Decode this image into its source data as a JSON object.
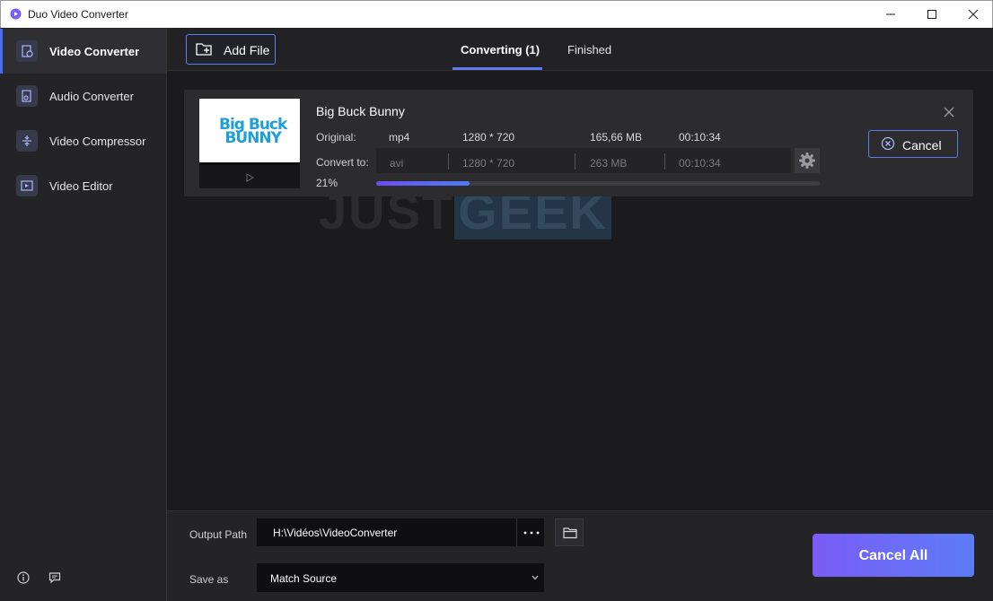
{
  "window": {
    "title": "Duo Video Converter",
    "icons": {
      "logo": "app-logo-icon",
      "minimize": "minimize-icon",
      "maximize": "maximize-icon",
      "close": "close-icon"
    }
  },
  "sidebar": {
    "items": [
      {
        "label": "Video Converter",
        "icon": "video-converter-icon",
        "active": true
      },
      {
        "label": "Audio Converter",
        "icon": "audio-converter-icon",
        "active": false
      },
      {
        "label": "Video Compressor",
        "icon": "video-compressor-icon",
        "active": false
      },
      {
        "label": "Video Editor",
        "icon": "video-editor-icon",
        "active": false
      }
    ],
    "footer_icons": [
      "info-icon",
      "feedback-icon"
    ]
  },
  "toolbar": {
    "add_file_label": "Add File",
    "add_file_icon": "add-file-icon",
    "tabs": [
      {
        "label": "Converting (1)",
        "active": true
      },
      {
        "label": "Finished",
        "active": false
      }
    ]
  },
  "watermark": {
    "part1": "JUST",
    "part2": "GEEK"
  },
  "task": {
    "thumbnail_text_line1": "Big Buck",
    "thumbnail_text_line2": "BUNNY",
    "title": "Big Buck Bunny",
    "original_label": "Original:",
    "original": {
      "format": "mp4",
      "resolution": "1280 * 720",
      "size": "165,66 MB",
      "duration": "00:10:34"
    },
    "convert_label": "Convert to:",
    "convert": {
      "format": "avi",
      "resolution": "1280 * 720",
      "size": "263 MB",
      "duration": "00:10:34"
    },
    "progress_text": "21%",
    "progress_fraction": 0.21,
    "cancel_label": "Cancel"
  },
  "bottom": {
    "output_path_label": "Output Path",
    "output_path": "H:\\Vidéos\\VideoConverter",
    "save_as_label": "Save as",
    "save_as_value": "Match Source",
    "cancel_all_label": "Cancel All"
  },
  "colors": {
    "accent": "#5f7cf5",
    "progress_start": "#6a4df0",
    "button_gradient_start": "#7a5cf6",
    "button_gradient_end": "#5d7cf6",
    "background": "#1b1b1d"
  }
}
